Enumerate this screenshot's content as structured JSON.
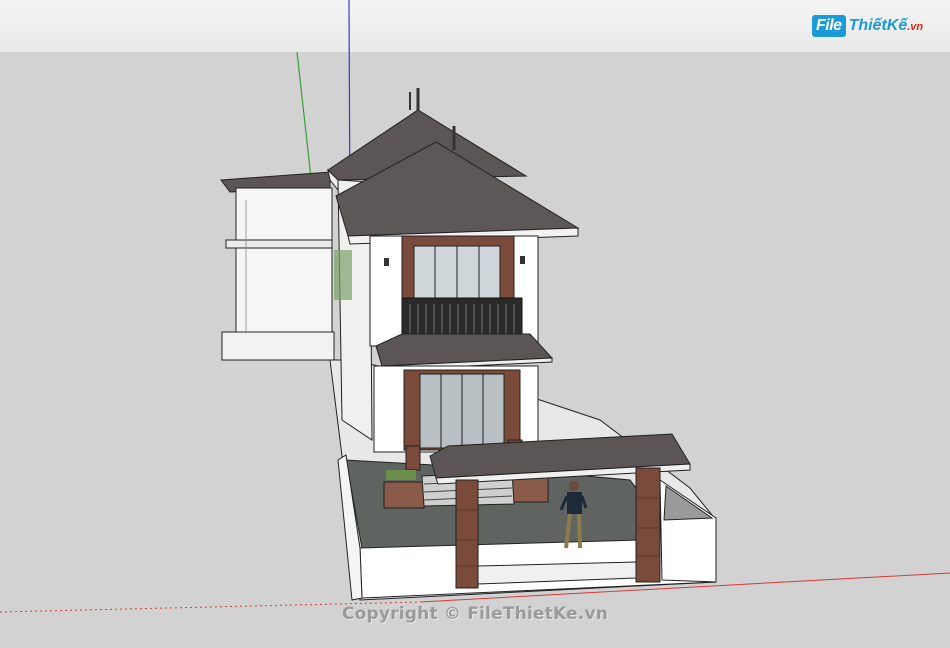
{
  "watermark": {
    "logo_mark": "File",
    "logo_name": "ThiếtKế",
    "logo_suffix": ".vn",
    "copyright": "Copyright © FileThietKe.vn"
  },
  "colors": {
    "background": "#d2d2d2",
    "roof": "#5b5555",
    "wall": "#ffffff",
    "brick": "#7a4a3a",
    "axis_red": "#d03030",
    "axis_green": "#30a030",
    "axis_blue": "#3030c0"
  }
}
